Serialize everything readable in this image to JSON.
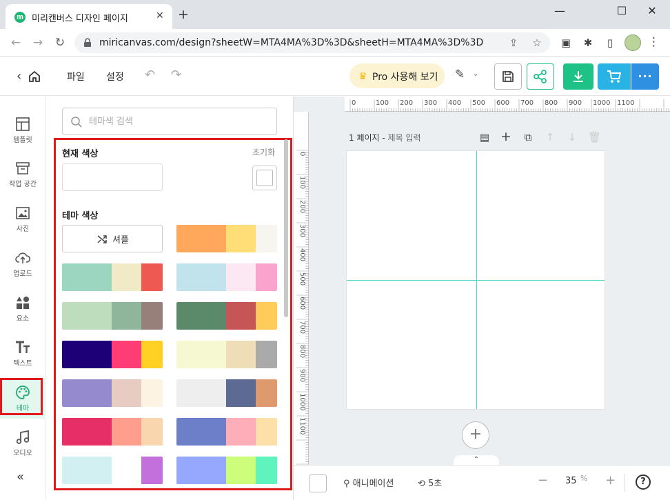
{
  "browser": {
    "tab_title": "미리캔버스 디자인 페이지",
    "favicon_letter": "m",
    "url": "miricanvas.com/design?sheetW=MTA4MA%3D%3D&sheetH=MTA4MA%3D%3D"
  },
  "header": {
    "menu_file": "파일",
    "menu_settings": "설정",
    "pro_label": "Pro 사용해 보기"
  },
  "sidebar": {
    "items": [
      {
        "label": "템플릿",
        "icon": "template-icon"
      },
      {
        "label": "작업 공간",
        "icon": "workspace-icon"
      },
      {
        "label": "사진",
        "icon": "photo-icon"
      },
      {
        "label": "업로드",
        "icon": "upload-icon"
      },
      {
        "label": "요소",
        "icon": "elements-icon"
      },
      {
        "label": "텍스트",
        "icon": "text-icon"
      },
      {
        "label": "테마",
        "icon": "theme-icon"
      },
      {
        "label": "오디오",
        "icon": "audio-icon"
      }
    ],
    "active": "테마"
  },
  "panel": {
    "search_placeholder": "테마색 검색",
    "current_title": "현재 색상",
    "reset_label": "초기화",
    "theme_title": "테마 색상",
    "shuffle_label": "셔플",
    "palettes": [
      [
        "#FFA85C",
        "#FFDD77",
        "#F8F4F0"
      ],
      [
        "#9CD5C0",
        "#F0EBC6",
        "#EE5A52"
      ],
      [
        "#C0E3EC",
        "#FCE8F3",
        "#FAA4CD"
      ],
      [
        "#BEDDBD",
        "#8FB69A",
        "#978079"
      ],
      [
        "#5A8A6A",
        "#C65556",
        "#FFCC5A"
      ],
      [
        "#1D0077",
        "#FE3C75",
        "#FFD124"
      ],
      [
        "#F5F8D1",
        "#EFDDB8",
        "#AAAAAA"
      ],
      [
        "#968ACF",
        "#E8CCC4",
        "#FDF3E2"
      ],
      [
        "#EEEEEE",
        "#5D6B94",
        "#DE9A6C"
      ],
      [
        "#E62E67",
        "#FF9E8D",
        "#F9D6AE"
      ],
      [
        "#6D7FC8",
        "#FDAEB8",
        "#FDE0A8"
      ],
      [
        "#D2F0F1",
        "#FFFFFF",
        "#C370DC"
      ],
      [
        "#96A7FE",
        "#CDFE7B",
        "#5FF3BE"
      ]
    ]
  },
  "canvas": {
    "page_label": "1 페이지 -",
    "page_title_placeholder": "제목 입력",
    "ruler_top": [
      "0",
      "100",
      "200",
      "300",
      "400",
      "500",
      "600",
      "700",
      "800",
      "900",
      "1000",
      "1100"
    ],
    "ruler_left": [
      "0",
      "100",
      "200",
      "300",
      "400",
      "500",
      "600",
      "700",
      "800",
      "900",
      "1000",
      "1100"
    ]
  },
  "bottom_bar": {
    "animation_label": "애니메이션",
    "duration_label": "5초",
    "zoom_value": "35",
    "zoom_unit": "%"
  },
  "colors": {
    "brand_green": "#1FC286",
    "highlight_red": "#E01A1A",
    "guide_cyan": "#52D6C9"
  }
}
